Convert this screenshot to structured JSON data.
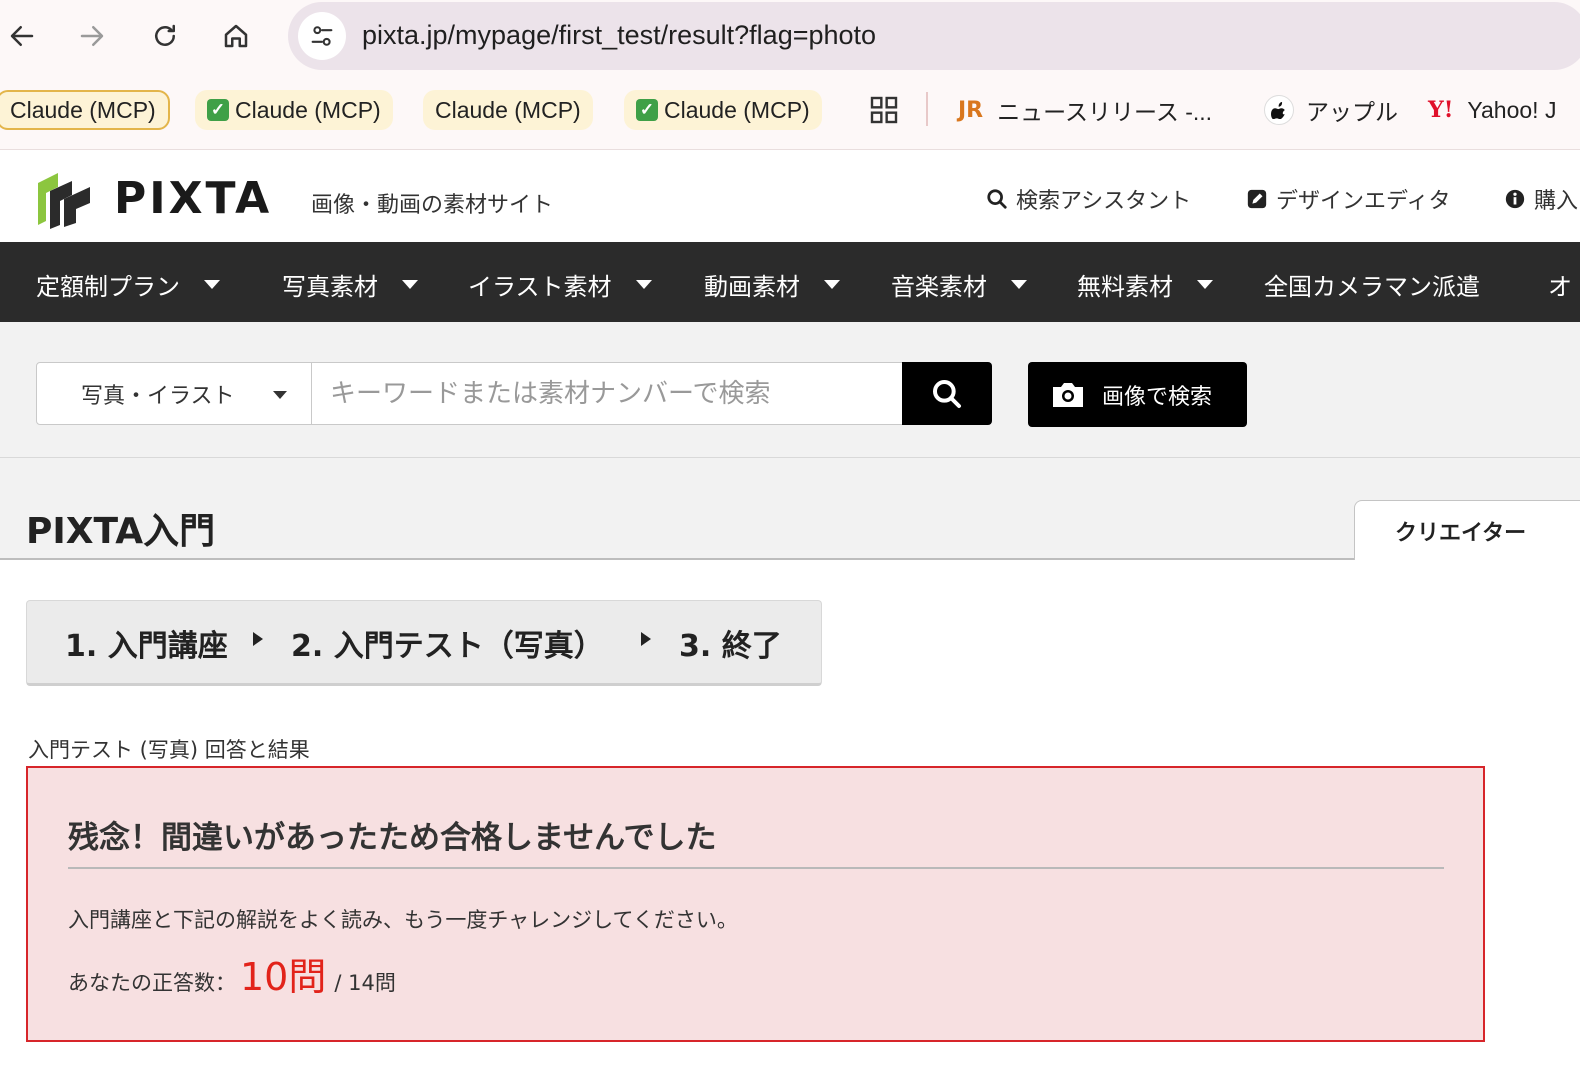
{
  "browser": {
    "url": "pixta.jp/mypage/first_test/result?flag=photo",
    "bookmarks": [
      {
        "label": "Claude (MCP)",
        "checked": false,
        "outlined": true
      },
      {
        "label": "Claude (MCP)",
        "checked": true,
        "outlined": false
      },
      {
        "label": "Claude (MCP)",
        "checked": false,
        "outlined": false
      },
      {
        "label": "Claude (MCP)",
        "checked": true,
        "outlined": false
      }
    ],
    "bookmark_jr": "ニュースリリース -...",
    "bookmark_apple": "アップル",
    "bookmark_yahoo": "Yahoo! J"
  },
  "header": {
    "logo": "PIXTA",
    "tagline": "画像・動画の素材サイト",
    "links": {
      "search_assistant": "検索アシスタント",
      "design_editor": "デザインエディタ",
      "purchase": "購入"
    }
  },
  "nav": {
    "items": [
      {
        "label": "定額制プラン",
        "dropdown": true
      },
      {
        "label": "写真素材",
        "dropdown": true
      },
      {
        "label": "イラスト素材",
        "dropdown": true
      },
      {
        "label": "動画素材",
        "dropdown": true
      },
      {
        "label": "音楽素材",
        "dropdown": true
      },
      {
        "label": "無料素材",
        "dropdown": true
      },
      {
        "label": "全国カメラマン派遣",
        "dropdown": false
      },
      {
        "label": "オ",
        "dropdown": false
      }
    ]
  },
  "search": {
    "category": "写真・イラスト",
    "placeholder": "キーワードまたは素材ナンバーで検索",
    "image_search_label": "画像で検索"
  },
  "page": {
    "title": "PIXTA入門",
    "creator_tab": "クリエイター"
  },
  "steps": {
    "step1": "1. 入門講座",
    "step2": "2. 入門テスト（写真）",
    "step3": "3. 終了"
  },
  "result": {
    "caption": "入門テスト (写真) 回答と結果",
    "heading": "残念！間違いがあったため合格しませんでした",
    "message": "入門講座と下記の解説をよく読み、もう一度チャレンジしてください。",
    "score_label": "あなたの正答数：",
    "score_value": "10問",
    "score_total": "/ 14問"
  },
  "colors": {
    "nav_bg": "#2b2b2b",
    "result_bg": "#f7e0e1",
    "result_border": "#d7252a",
    "score": "#e2231a",
    "logo_green": "#8cc63f"
  }
}
